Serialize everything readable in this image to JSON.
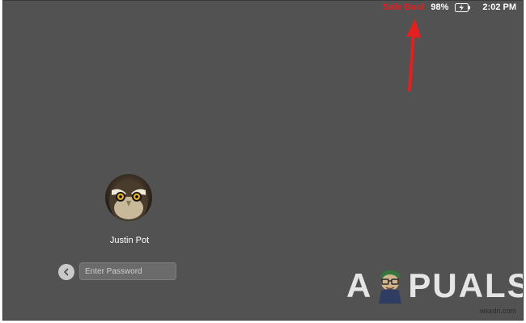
{
  "menubar": {
    "safe_boot": "Safe Boot",
    "battery_percent": "98%",
    "battery_icon": "battery-charging-icon",
    "time": "2:02 PM"
  },
  "annotation": {
    "arrow_icon": "red-arrow-icon",
    "arrow_color": "#e41f1f"
  },
  "login": {
    "avatar_icon": "owl-avatar",
    "user_name": "Justin Pot",
    "back_icon": "chevron-left-icon",
    "password_placeholder": "Enter Password",
    "password_value": ""
  },
  "watermark": {
    "brand_letter_a": "A",
    "brand_mascot": "appuals-mascot",
    "brand_rest": "PUALS",
    "credit": "wsxdn.com"
  },
  "colors": {
    "background": "#525252",
    "accent_red": "#e41f1f",
    "text": "#ffffff"
  }
}
